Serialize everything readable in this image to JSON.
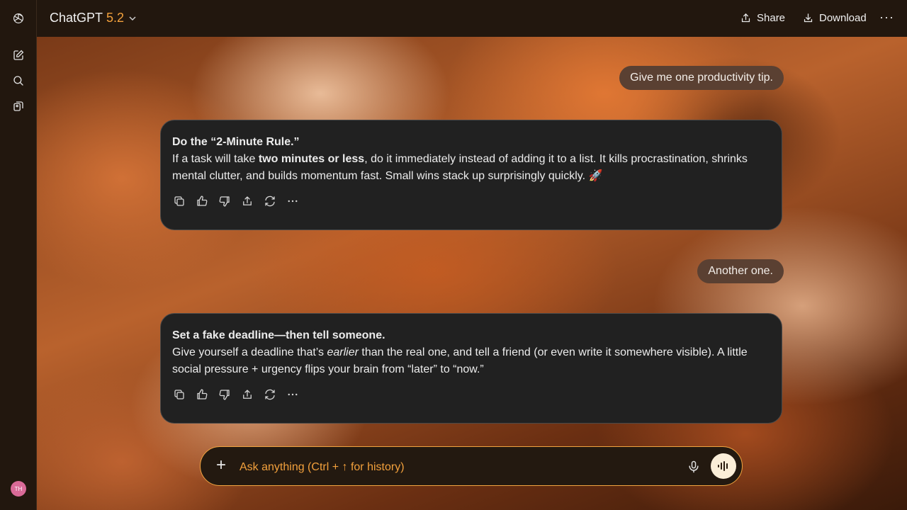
{
  "header": {
    "model_name": "ChatGPT",
    "model_version": "5.2",
    "share_label": "Share",
    "download_label": "Download",
    "more_label": "···"
  },
  "sidebar": {
    "avatar_initials": "TH",
    "items": [
      {
        "icon": "new-chat-icon"
      },
      {
        "icon": "search-icon"
      },
      {
        "icon": "library-icon"
      }
    ]
  },
  "messages": [
    {
      "role": "user",
      "text": "Give me one productivity tip."
    },
    {
      "role": "assistant",
      "title": "Do the “2-Minute Rule.”",
      "body_prefix": "If a task will take ",
      "body_bold": "two minutes or less",
      "body_suffix": ", do it immediately instead of adding it to a list. It kills procrastination, shrinks mental clutter, and builds momentum fast. Small wins stack up surprisingly quickly. 🚀"
    },
    {
      "role": "user",
      "text": "Another one."
    },
    {
      "role": "assistant",
      "title": "Set a fake deadline—then tell someone.",
      "body_prefix": "Give yourself a deadline that’s ",
      "body_italic": "earlier",
      "body_suffix": " than the real one, and tell a friend (or even write it somewhere visible). A little social pressure + urgency flips your brain from “later” to “now.”"
    }
  ],
  "composer": {
    "placeholder": "Ask anything (Ctrl + ↑ for history)",
    "value": ""
  },
  "colors": {
    "accent": "#f2a03c",
    "card_bg": "#212121",
    "user_bubble_bg": "#5a4032"
  }
}
